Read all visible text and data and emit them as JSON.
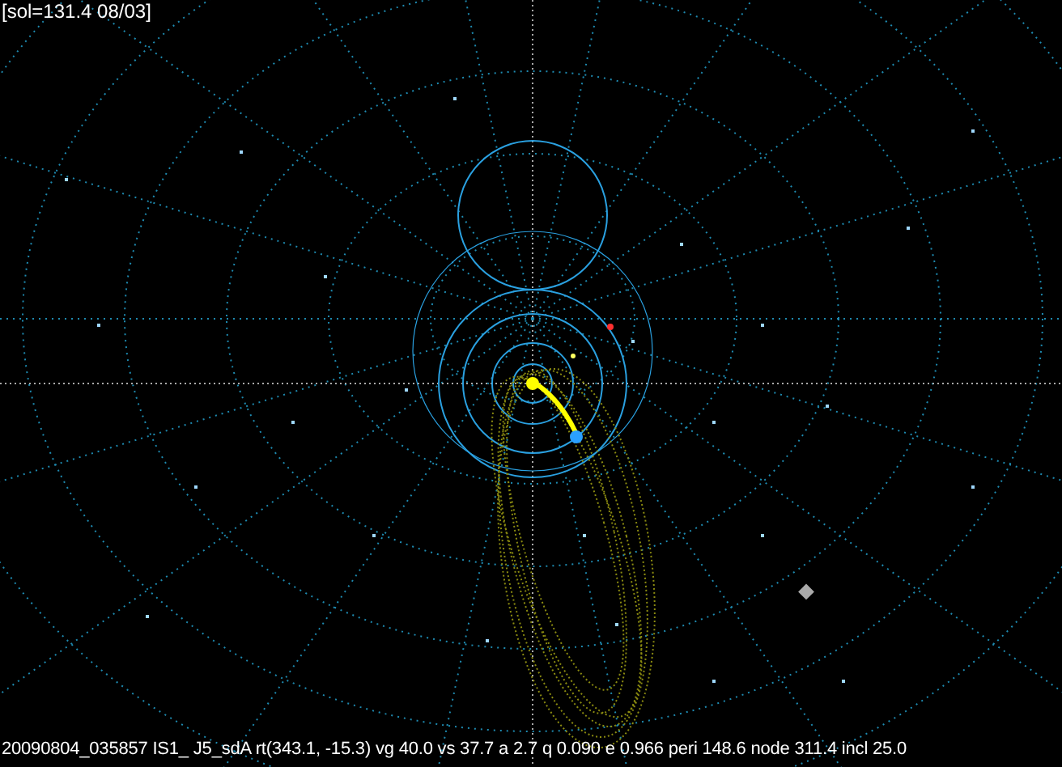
{
  "header": {
    "text": "[sol=131.4 08/03]"
  },
  "footer": {
    "text": "20090804_035857 IS1_  J5_sdA rt(343.1, -15.3) vg 40.0 vs 37.7 a 2.7 q 0.090 e 0.966 peri 148.6 node 311.4 incl 25.0"
  }
}
